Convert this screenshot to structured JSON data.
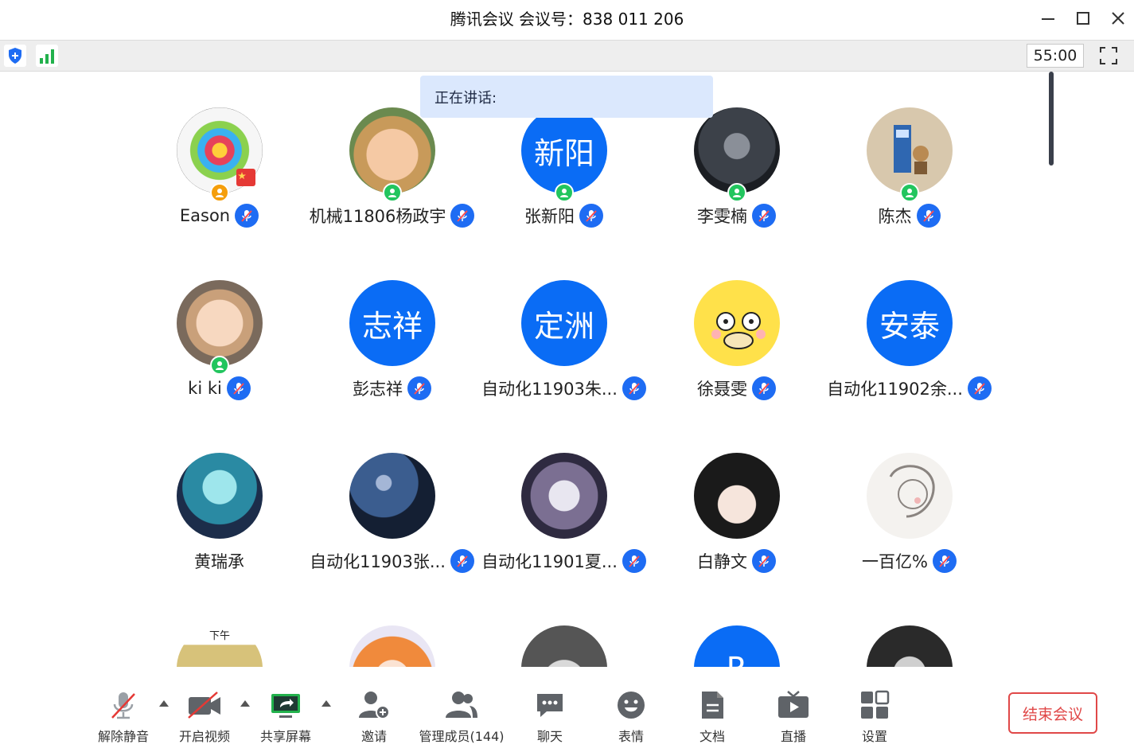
{
  "window": {
    "title": "腾讯会议 会议号：838 011 206"
  },
  "statusbar": {
    "timer": "55:00"
  },
  "speaking_banner": "正在讲话:",
  "participants": [
    {
      "name": "Eason",
      "avatar_text": "",
      "status": "host"
    },
    {
      "name": "机械11806杨政宇",
      "avatar_text": "",
      "status": "online"
    },
    {
      "name": "张新阳",
      "avatar_text": "新阳",
      "status": "online"
    },
    {
      "name": "李雯楠",
      "avatar_text": "",
      "status": "online"
    },
    {
      "name": "陈杰",
      "avatar_text": "",
      "status": "online"
    },
    {
      "name": "ki ki",
      "avatar_text": "",
      "status": "online"
    },
    {
      "name": "彭志祥",
      "avatar_text": "志祥",
      "status": ""
    },
    {
      "name": "自动化11903朱...",
      "avatar_text": "定洲",
      "status": ""
    },
    {
      "name": "徐聂雯",
      "avatar_text": "",
      "status": ""
    },
    {
      "name": "自动化11902余...",
      "avatar_text": "安泰",
      "status": ""
    },
    {
      "name": "黄瑞承",
      "avatar_text": "",
      "status": ""
    },
    {
      "name": "自动化11903张...",
      "avatar_text": "",
      "status": ""
    },
    {
      "name": "自动化11901夏...",
      "avatar_text": "",
      "status": ""
    },
    {
      "name": "白静文",
      "avatar_text": "",
      "status": ""
    },
    {
      "name": "一百亿%",
      "avatar_text": "",
      "status": ""
    },
    {
      "name": "",
      "avatar_text": "下午",
      "status": ""
    },
    {
      "name": "",
      "avatar_text": "",
      "status": ""
    },
    {
      "name": "",
      "avatar_text": "",
      "status": ""
    },
    {
      "name": "",
      "avatar_text": "R",
      "status": ""
    },
    {
      "name": "",
      "avatar_text": "",
      "status": ""
    }
  ],
  "toolbar": {
    "unmute": "解除静音",
    "start_video": "开启视频",
    "share_screen": "共享屏幕",
    "invite": "邀请",
    "manage_members": "管理成员(144)",
    "chat": "聊天",
    "reactions": "表情",
    "docs": "文档",
    "live": "直播",
    "settings": "设置",
    "end_meeting": "结束会议"
  },
  "colors": {
    "brand_blue": "#1e6cf3",
    "avatar_blue": "#0a6cf5",
    "online_green": "#22c55e",
    "host_orange": "#f59e0b",
    "end_red": "#e04848"
  }
}
